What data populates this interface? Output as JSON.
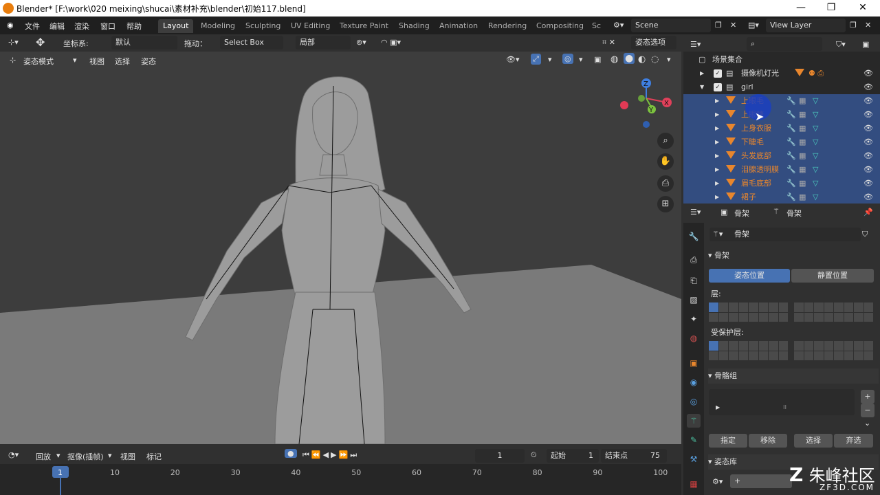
{
  "window": {
    "title": "Blender* [F:\\work\\020 meixing\\shucai\\素材补充\\blender\\初始117.blend]",
    "min": "—",
    "max": "❐",
    "close": "✕"
  },
  "menu": [
    "文件",
    "编辑",
    "渲染",
    "窗口",
    "帮助"
  ],
  "workspaces": [
    {
      "label": "Layout",
      "active": true
    },
    {
      "label": "Modeling"
    },
    {
      "label": "Sculpting"
    },
    {
      "label": "UV Editing"
    },
    {
      "label": "Texture Paint"
    },
    {
      "label": "Shading"
    },
    {
      "label": "Animation"
    },
    {
      "label": "Rendering"
    },
    {
      "label": "Compositing"
    },
    {
      "label": "Sc"
    }
  ],
  "scene": {
    "name": "Scene",
    "view_layer": "View Layer"
  },
  "toolbar": {
    "coord_label": "坐标系:",
    "coord_value": "默认",
    "drag_label": "拖动：",
    "drag_value": "Select Box",
    "pivot": "局部",
    "pose_options": "姿态选项"
  },
  "viewport_header": {
    "mode": "姿态模式",
    "view": "视图",
    "select": "选择",
    "pose": "姿态"
  },
  "gizmo": {
    "z": "Z",
    "x": "X",
    "y": "Y"
  },
  "outliner": {
    "root": "场景集合",
    "items": [
      {
        "name": "摄像机灯光",
        "depth": 1,
        "checked": true,
        "selected": false,
        "color": "#dcdcdc"
      },
      {
        "name": "girl",
        "depth": 1,
        "checked": true,
        "selected": false,
        "color": "#dcdcdc"
      },
      {
        "name": "上眼毛",
        "depth": 2,
        "selected": true,
        "color": "#e8862d"
      },
      {
        "name": "上眼睫",
        "depth": 2,
        "selected": true,
        "color": "#e8862d"
      },
      {
        "name": "上身衣服",
        "depth": 2,
        "selected": true,
        "color": "#e8862d"
      },
      {
        "name": "下睫毛",
        "depth": 2,
        "selected": true,
        "color": "#e8862d"
      },
      {
        "name": "头发底部",
        "depth": 2,
        "selected": true,
        "color": "#e8862d"
      },
      {
        "name": "泪腺透明膜",
        "depth": 2,
        "selected": true,
        "color": "#e8862d"
      },
      {
        "name": "眉毛底部",
        "depth": 2,
        "selected": true,
        "color": "#e8862d"
      },
      {
        "name": "裙子",
        "depth": 2,
        "selected": true,
        "color": "#e8862d"
      }
    ]
  },
  "properties": {
    "breadcrumb1": "骨架",
    "breadcrumb2": "骨架",
    "data_name": "骨架",
    "section_skeleton": "骨架",
    "pose_position": "姿态位置",
    "rest_position": "静置位置",
    "layers_label": "层:",
    "protected_label": "受保护层:",
    "bone_groups": "骨骼组",
    "assign": "指定",
    "remove": "移除",
    "select": "选择",
    "deselect": "弃选",
    "pose_library": "姿态库",
    "add": "+"
  },
  "timeline": {
    "playback": "回放",
    "keying": "抠像(插帧)",
    "view": "视图",
    "marker": "标记",
    "current_frame": "1",
    "start_label": "起始",
    "start": "1",
    "end_label": "结束点",
    "end": "75",
    "ticks": [
      "1",
      "10",
      "20",
      "30",
      "40",
      "50",
      "60",
      "70",
      "80",
      "90",
      "100"
    ]
  },
  "watermark": {
    "brand": "朱峰社区",
    "url": "ZF3D.COM"
  },
  "colors": {
    "accent": "#4772b3",
    "selection": "#334d80",
    "orange": "#e8862d"
  }
}
